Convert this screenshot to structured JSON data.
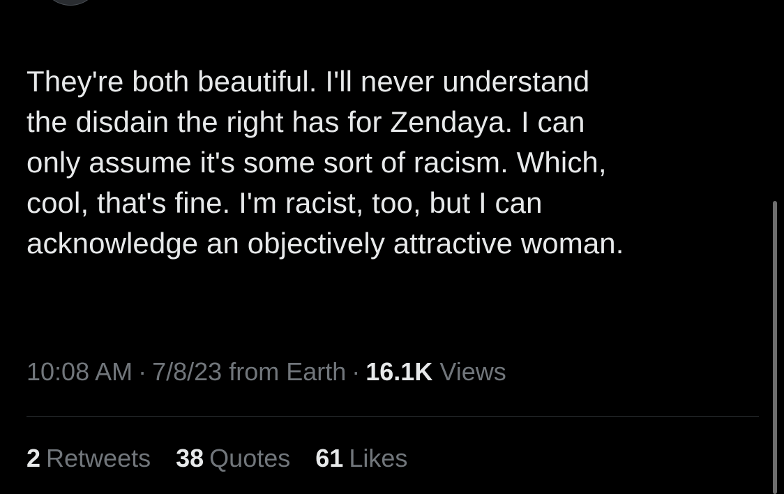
{
  "tweet": {
    "lines": [
      "They're both beautiful. I'll never understand",
      "the disdain the right has for Zendaya. I can",
      "only assume it's some sort of racism. Which,",
      "cool, that's fine. I'm racist, too, but I can",
      "acknowledge an objectively attractive woman."
    ]
  },
  "meta": {
    "time": "10:08 AM",
    "separator": "·",
    "date": "7/8/23",
    "source": "from Earth",
    "views_count": "16.1K",
    "views_label": "Views"
  },
  "stats": {
    "retweets_count": "2",
    "retweets_label": "Retweets",
    "quotes_count": "38",
    "quotes_label": "Quotes",
    "likes_count": "61",
    "likes_label": "Likes"
  },
  "colors": {
    "background": "#000000",
    "primary_text": "#e7e9ea",
    "secondary_text": "#71767b",
    "divider": "#2f3336"
  }
}
